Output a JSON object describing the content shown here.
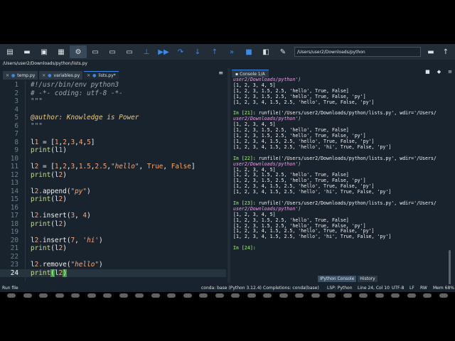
{
  "toolbar": {
    "icons": [
      "new-file-icon",
      "open-folder-icon",
      "save-icon",
      "save-all-icon",
      "new-project-icon",
      "run-icon",
      "run-cell-icon",
      "run-cell-advance-icon",
      "run-selection-icon",
      "debug-icon",
      "step-icon",
      "step-into-icon",
      "step-return-icon",
      "continue-icon",
      "stop-icon",
      "maximize-pane-icon",
      "preferences-icon",
      "python-path-icon"
    ],
    "working_dir": "/Users/user2/Downloads/python"
  },
  "path_bar": "/Users/user2/Downloads/python/lists.py",
  "editor": {
    "tabs": [
      {
        "label": "temp.py",
        "active": false
      },
      {
        "label": "variables.py",
        "active": false
      },
      {
        "label": "lists.py*",
        "active": true
      }
    ],
    "lines": [
      {
        "n": "1",
        "t": "#!/usr/bin/env python3"
      },
      {
        "n": "2",
        "t": "# -*- coding: utf-8 -*-"
      },
      {
        "n": "3",
        "t": "\"\"\""
      },
      {
        "n": "4",
        "t": ""
      },
      {
        "n": "5",
        "t": "@author: Knowledge is Power"
      },
      {
        "n": "6",
        "t": "\"\"\""
      },
      {
        "n": "7",
        "t": ""
      },
      {
        "n": "8",
        "t": "l1 = [1,2,3,4,5]"
      },
      {
        "n": "9",
        "t": "print(l1)"
      },
      {
        "n": "10",
        "t": ""
      },
      {
        "n": "11",
        "t": "l2 = [1,2,3,1.5,2.5,\"hello\", True, False]"
      },
      {
        "n": "12",
        "t": "print(l2)"
      },
      {
        "n": "13",
        "t": ""
      },
      {
        "n": "14",
        "t": "l2.append(\"py\")"
      },
      {
        "n": "15",
        "t": "print(l2)"
      },
      {
        "n": "16",
        "t": ""
      },
      {
        "n": "17",
        "t": "l2.insert(3, 4)"
      },
      {
        "n": "18",
        "t": "print(l2)"
      },
      {
        "n": "19",
        "t": ""
      },
      {
        "n": "20",
        "t": "l2.insert(7, 'hi')"
      },
      {
        "n": "21",
        "t": "print(l2)"
      },
      {
        "n": "22",
        "t": ""
      },
      {
        "n": "23",
        "t": "l2.remove(\"hello\")"
      },
      {
        "n": "24",
        "t": "print(l2)"
      }
    ],
    "current_line": 24
  },
  "console": {
    "tab_label": "Console 1/A",
    "lines": [
      {
        "k": "path",
        "t": "user2/Downloads/python')"
      },
      {
        "k": "out",
        "t": "[1, 2, 3, 4, 5]"
      },
      {
        "k": "out",
        "t": "[1, 2, 3, 1.5, 2.5, 'hello', True, False]"
      },
      {
        "k": "out",
        "t": "[1, 2, 3, 1.5, 2.5, 'hello', True, False, 'py']"
      },
      {
        "k": "out",
        "t": "[1, 2, 3, 4, 1.5, 2.5, 'hello', True, False, 'py']"
      },
      {
        "k": "blank",
        "t": ""
      },
      {
        "k": "in",
        "p": "In [21]:",
        "t": " runfile('/Users/user2/Downloads/python/lists.py', wdir='/Users/"
      },
      {
        "k": "path",
        "t": "user2/Downloads/python')"
      },
      {
        "k": "out",
        "t": "[1, 2, 3, 4, 5]"
      },
      {
        "k": "out",
        "t": "[1, 2, 3, 1.5, 2.5, 'hello', True, False]"
      },
      {
        "k": "out",
        "t": "[1, 2, 3, 1.5, 2.5, 'hello', True, False, 'py']"
      },
      {
        "k": "out",
        "t": "[1, 2, 3, 4, 1.5, 2.5, 'hello', True, False, 'py']"
      },
      {
        "k": "out",
        "t": "[1, 2, 3, 4, 1.5, 2.5, 'hello', 'hi', True, False, 'py']"
      },
      {
        "k": "blank",
        "t": ""
      },
      {
        "k": "in",
        "p": "In [22]:",
        "t": " runfile('/Users/user2/Downloads/python/lists.py', wdir='/Users/"
      },
      {
        "k": "path",
        "t": "user2/Downloads/python')"
      },
      {
        "k": "out",
        "t": "[1, 2, 3, 4, 5]"
      },
      {
        "k": "out",
        "t": "[1, 2, 3, 1.5, 2.5, 'hello', True, False]"
      },
      {
        "k": "out",
        "t": "[1, 2, 3, 1.5, 2.5, 'hello', True, False, 'py']"
      },
      {
        "k": "out",
        "t": "[1, 2, 3, 4, 1.5, 2.5, 'hello', True, False, 'py']"
      },
      {
        "k": "out",
        "t": "[1, 2, 3, 4, 1.5, 2.5, 'hello', 'hi', True, False, 'py']"
      },
      {
        "k": "blank",
        "t": ""
      },
      {
        "k": "in",
        "p": "In [23]:",
        "t": " runfile('/Users/user2/Downloads/python/lists.py', wdir='/Users/"
      },
      {
        "k": "path",
        "t": "user2/Downloads/python')"
      },
      {
        "k": "out",
        "t": "[1, 2, 3, 4, 5]"
      },
      {
        "k": "out",
        "t": "[1, 2, 3, 1.5, 2.5, 'hello', True, False]"
      },
      {
        "k": "out",
        "t": "[1, 2, 3, 1.5, 2.5, 'hello', True, False, 'py']"
      },
      {
        "k": "out",
        "t": "[1, 2, 3, 4, 1.5, 2.5, 'hello', True, False, 'py']"
      },
      {
        "k": "out",
        "t": "[1, 2, 3, 4, 1.5, 2.5, 'hello', 'hi', True, False, 'py']"
      },
      {
        "k": "blank",
        "t": ""
      },
      {
        "k": "in",
        "p": "In [24]:",
        "t": ""
      }
    ],
    "bottom_tabs": [
      {
        "label": "IPython Console",
        "active": true
      },
      {
        "label": "History",
        "active": false
      }
    ]
  },
  "status": {
    "left": "Run file",
    "conda": "conda: base (Python 3.12.4)",
    "completions": "Completions: conda(base)",
    "lsp": "LSP: Python",
    "position": "Line 24, Col 10",
    "encoding": "UTF-8",
    "eol": "LF",
    "rw": "RW",
    "mem": "Mem 68%"
  }
}
